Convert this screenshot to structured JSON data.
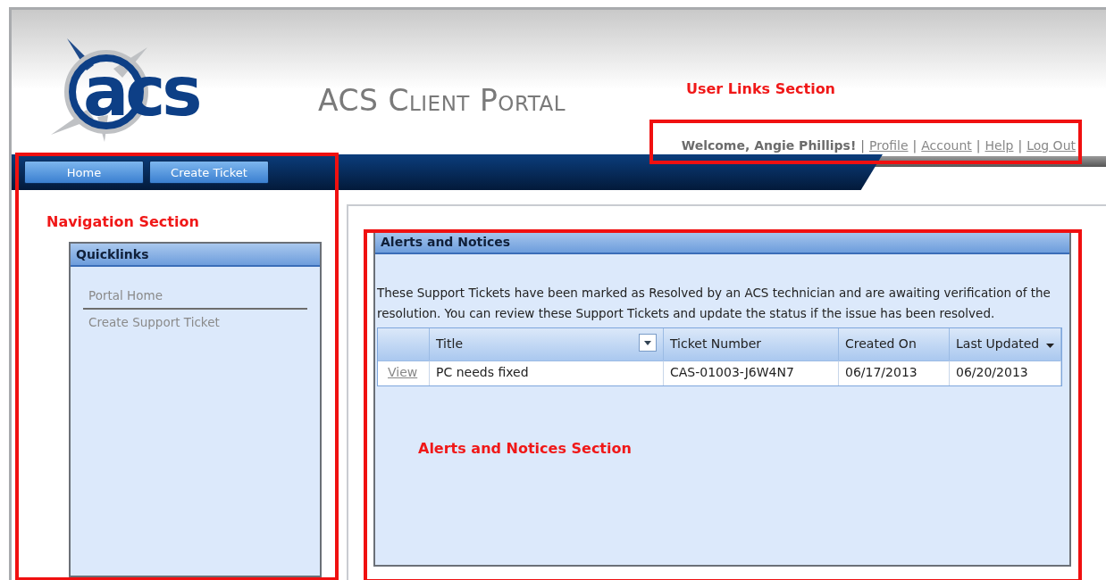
{
  "header": {
    "logo_text": "acs",
    "title": "ACS Client Portal",
    "welcome": "Welcome, Angie Phillips!",
    "separator": "|",
    "links": [
      "Profile",
      "Account",
      "Help",
      "Log Out"
    ]
  },
  "nav_buttons": [
    "Home",
    "Create Ticket"
  ],
  "quicklinks": {
    "title": "Quicklinks",
    "items": [
      "Portal Home",
      "Create Support Ticket"
    ]
  },
  "alerts": {
    "title": "Alerts and Notices",
    "message": "These Support Tickets have been marked as Resolved by an ACS technician and are awaiting verification of the resolution. You can review these Support Tickets and update the status if the issue has been resolved.",
    "table": {
      "columns": [
        "Title",
        "Ticket Number",
        "Created On",
        "Last Updated"
      ],
      "rows": [
        {
          "action": "View",
          "cells": [
            "PC needs fixed",
            "CAS-01003-J6W4N7",
            "06/17/2013",
            "06/20/2013"
          ]
        }
      ]
    }
  },
  "annotations": [
    {
      "label": "User Links Section"
    },
    {
      "label": "Navigation Section"
    },
    {
      "label": "Alerts and Notices Section"
    }
  ]
}
